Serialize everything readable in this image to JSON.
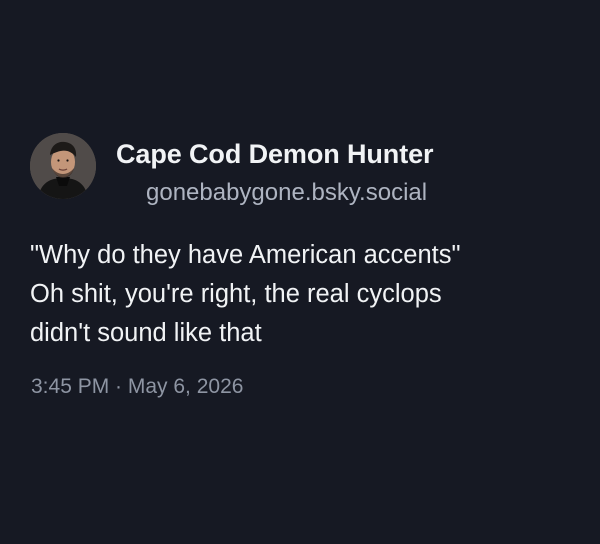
{
  "post": {
    "author": {
      "display_name": "Cape Cod Demon Hunter",
      "handle": "gonebabygone.bsky.social",
      "avatar": "profile-photo"
    },
    "text_lines": [
      "\"Why do they have American accents\"",
      "Oh shit, you're right, the real cyclops",
      "didn't sound like that"
    ],
    "timestamp": "3:45 PM · May 6, 2026"
  },
  "colors": {
    "background": "#161923",
    "primary_text": "#f1f3f5",
    "secondary_text": "#aeb4c1",
    "timestamp_text": "#8e95a3"
  }
}
